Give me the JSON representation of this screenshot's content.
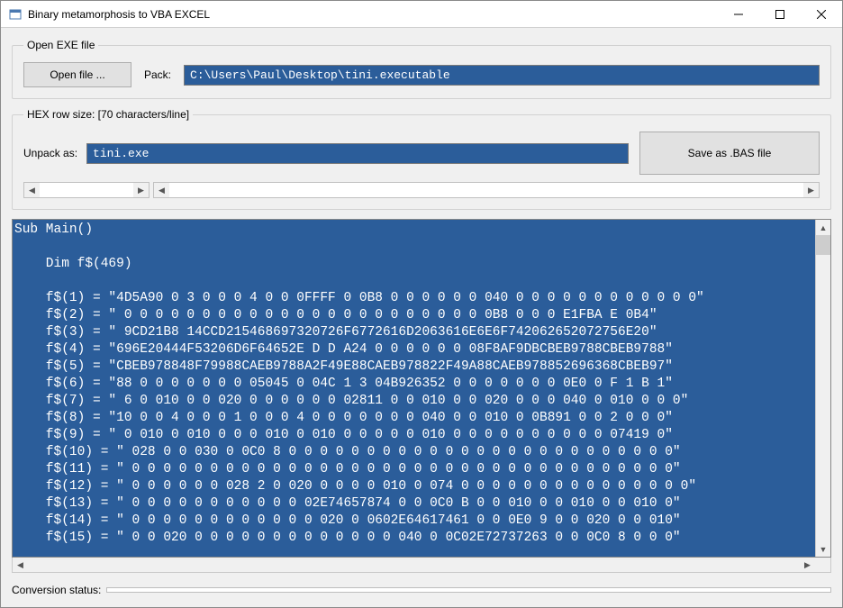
{
  "window": {
    "title": "Binary metamorphosis to VBA EXCEL"
  },
  "open_group": {
    "legend": "Open EXE file",
    "open_button": "Open file ...",
    "pack_label": "Pack:",
    "pack_value": "C:\\Users\\Paul\\Desktop\\tini.executable"
  },
  "hex_group": {
    "legend": "HEX row size: [70 characters/line]",
    "unpack_label": "Unpack as:",
    "unpack_value": "tini.exe",
    "save_button": "Save as .BAS file"
  },
  "code": {
    "sub_line": "Sub Main()",
    "dim_line": "    Dim f$(469)",
    "lines": [
      "    f$(1) = \"4D5A90 0 3 0 0 0 4 0 0 0FFFF 0 0B8 0 0 0 0 0 0 040 0 0 0 0 0 0 0 0 0 0 0 0\"",
      "    f$(2) = \" 0 0 0 0 0 0 0 0 0 0 0 0 0 0 0 0 0 0 0 0 0 0 0 0B8 0 0 0 E1FBA E 0B4\"",
      "    f$(3) = \" 9CD21B8 14CCD215468697320726F6772616D2063616E6E6F742062652072756E20\"",
      "    f$(4) = \"696E20444F53206D6F64652E D D A24 0 0 0 0 0 0 08F8AF9DBCBEB9788CBEB9788\"",
      "    f$(5) = \"CBEB978848F79988CAEB9788A2F49E88CAEB978822F49A88CAEB978852696368CBEB97\"",
      "    f$(6) = \"88 0 0 0 0 0 0 0 05045 0 04C 1 3 04B926352 0 0 0 0 0 0 0 0E0 0 F 1 B 1\"",
      "    f$(7) = \" 6 0 010 0 0 020 0 0 0 0 0 0 02811 0 0 010 0 0 020 0 0 0 040 0 010 0 0 0\"",
      "    f$(8) = \"10 0 0 4 0 0 0 1 0 0 0 4 0 0 0 0 0 0 0 040 0 0 010 0 0B891 0 0 2 0 0 0\"",
      "    f$(9) = \" 0 010 0 010 0 0 0 010 0 010 0 0 0 0 0 010 0 0 0 0 0 0 0 0 0 0 07419 0\"",
      "    f$(10) = \" 028 0 0 030 0 0C0 8 0 0 0 0 0 0 0 0 0 0 0 0 0 0 0 0 0 0 0 0 0 0 0 0 0\"",
      "    f$(11) = \" 0 0 0 0 0 0 0 0 0 0 0 0 0 0 0 0 0 0 0 0 0 0 0 0 0 0 0 0 0 0 0 0 0 0 0\"",
      "    f$(12) = \" 0 0 0 0 0 0 028 2 0 020 0 0 0 0 010 0 074 0 0 0 0 0 0 0 0 0 0 0 0 0 0 0\"",
      "    f$(13) = \" 0 0 0 0 0 0 0 0 0 0 0 02E74657874 0 0 0C0 B 0 0 010 0 0 010 0 0 010 0\"",
      "    f$(14) = \" 0 0 0 0 0 0 0 0 0 0 0 0 020 0 0602E64617461 0 0 0E0 9 0 0 020 0 0 010\"",
      "    f$(15) = \" 0 0 020 0 0 0 0 0 0 0 0 0 0 0 0 0 040 0 0C02E72737263 0 0 0C0 8 0 0 0\""
    ]
  },
  "status": {
    "label": "Conversion status:"
  }
}
